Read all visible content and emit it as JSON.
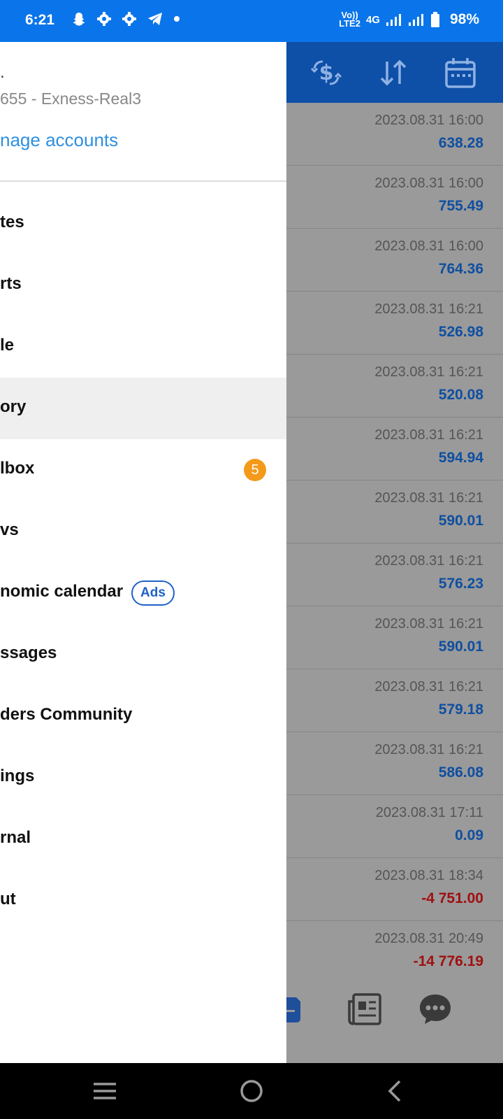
{
  "status_bar": {
    "time": "6:21",
    "network_top": "Vo))",
    "network_bottom": "LTE2",
    "network_type": "4G",
    "battery": "98%"
  },
  "drawer": {
    "account_name": ".",
    "account_server": "655 - Exness-Real3",
    "manage_accounts": "nage accounts",
    "menu": [
      {
        "label": "tes"
      },
      {
        "label": "rts"
      },
      {
        "label": "le"
      },
      {
        "label": "ory"
      },
      {
        "label": "lbox",
        "badge": "5"
      },
      {
        "label": "vs"
      },
      {
        "label": "nomic calendar",
        "tag": "Ads"
      },
      {
        "label": "ssages"
      },
      {
        "label": "ders Community"
      },
      {
        "label": "ings"
      },
      {
        "label": "rnal"
      },
      {
        "label": "ut"
      }
    ]
  },
  "history": {
    "rows": [
      {
        "date": "2023.08.31 16:00",
        "amount": "638.28"
      },
      {
        "date": "2023.08.31 16:00",
        "amount": "755.49"
      },
      {
        "date": "2023.08.31 16:00",
        "amount": "764.36"
      },
      {
        "date": "2023.08.31 16:21",
        "amount": "526.98"
      },
      {
        "date": "2023.08.31 16:21",
        "amount": "520.08"
      },
      {
        "date": "2023.08.31 16:21",
        "amount": "594.94"
      },
      {
        "date": "2023.08.31 16:21",
        "amount": "590.01"
      },
      {
        "date": "2023.08.31 16:21",
        "amount": "576.23"
      },
      {
        "date": "2023.08.31 16:21",
        "amount": "590.01"
      },
      {
        "date": "2023.08.31 16:21",
        "amount": "579.18"
      },
      {
        "date": "2023.08.31 16:21",
        "amount": "586.08"
      },
      {
        "date": "2023.08.31 17:11",
        "amount": "0.09"
      },
      {
        "date": "2023.08.31 18:34",
        "amount": "-4 751.00"
      },
      {
        "date": "2023.08.31 20:49",
        "amount": "-14 776.19"
      }
    ]
  },
  "colors": {
    "status_bar": "#0a75ea",
    "toolbar": "#0e4fa8",
    "positive_amount": "#0f4fa0",
    "negative_amount": "#a01010",
    "link": "#2f8fe0",
    "badge": "#f49a1a",
    "ads_tag": "#1e62c9"
  },
  "icons": {
    "status_left": [
      "snapchat-icon",
      "gear-icon",
      "gear-icon",
      "telegram-icon",
      "dot-icon"
    ],
    "toolbar": [
      "currency-exchange-icon",
      "sort-icon",
      "calendar-icon"
    ],
    "bottom_tabs": [
      "history-tab-icon",
      "news-icon",
      "messages-icon"
    ],
    "nav": [
      "recent-apps-icon",
      "home-icon",
      "back-icon"
    ]
  }
}
